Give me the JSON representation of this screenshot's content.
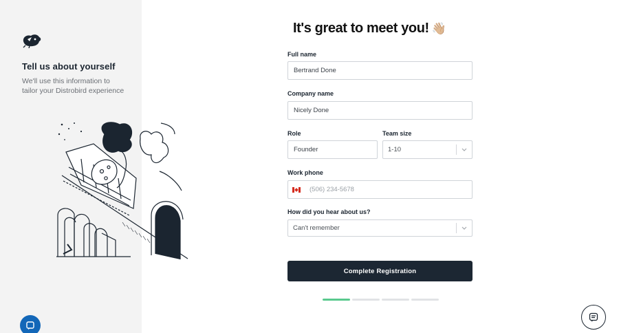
{
  "sidebar": {
    "logo_icon": "distrobird-logo-icon",
    "title": "Tell us about yourself",
    "description": "We'll use this information to tailor your Distrobird experience",
    "illustration": "person-riding-train-illustration"
  },
  "form": {
    "heading": "It's great to meet you!",
    "heading_emoji": "👋🏼",
    "full_name": {
      "label": "Full name",
      "value": "Bertrand Done"
    },
    "company_name": {
      "label": "Company name",
      "value": "Nicely Done"
    },
    "role": {
      "label": "Role",
      "value": "Founder"
    },
    "team_size": {
      "label": "Team size",
      "value": "1-10"
    },
    "work_phone": {
      "label": "Work phone",
      "placeholder": "(506) 234-5678",
      "country_flag": "canada-flag-icon"
    },
    "referral": {
      "label": "How did you hear about us?",
      "value": "Can't remember"
    },
    "submit_label": "Complete Registration"
  },
  "progress": {
    "total_steps": 4,
    "current_step": 1
  },
  "colors": {
    "primary": "#1c2733",
    "progress_active": "#59c98d",
    "sidebar_bg": "#f3f3f3",
    "chat_launcher": "#1367b8"
  }
}
